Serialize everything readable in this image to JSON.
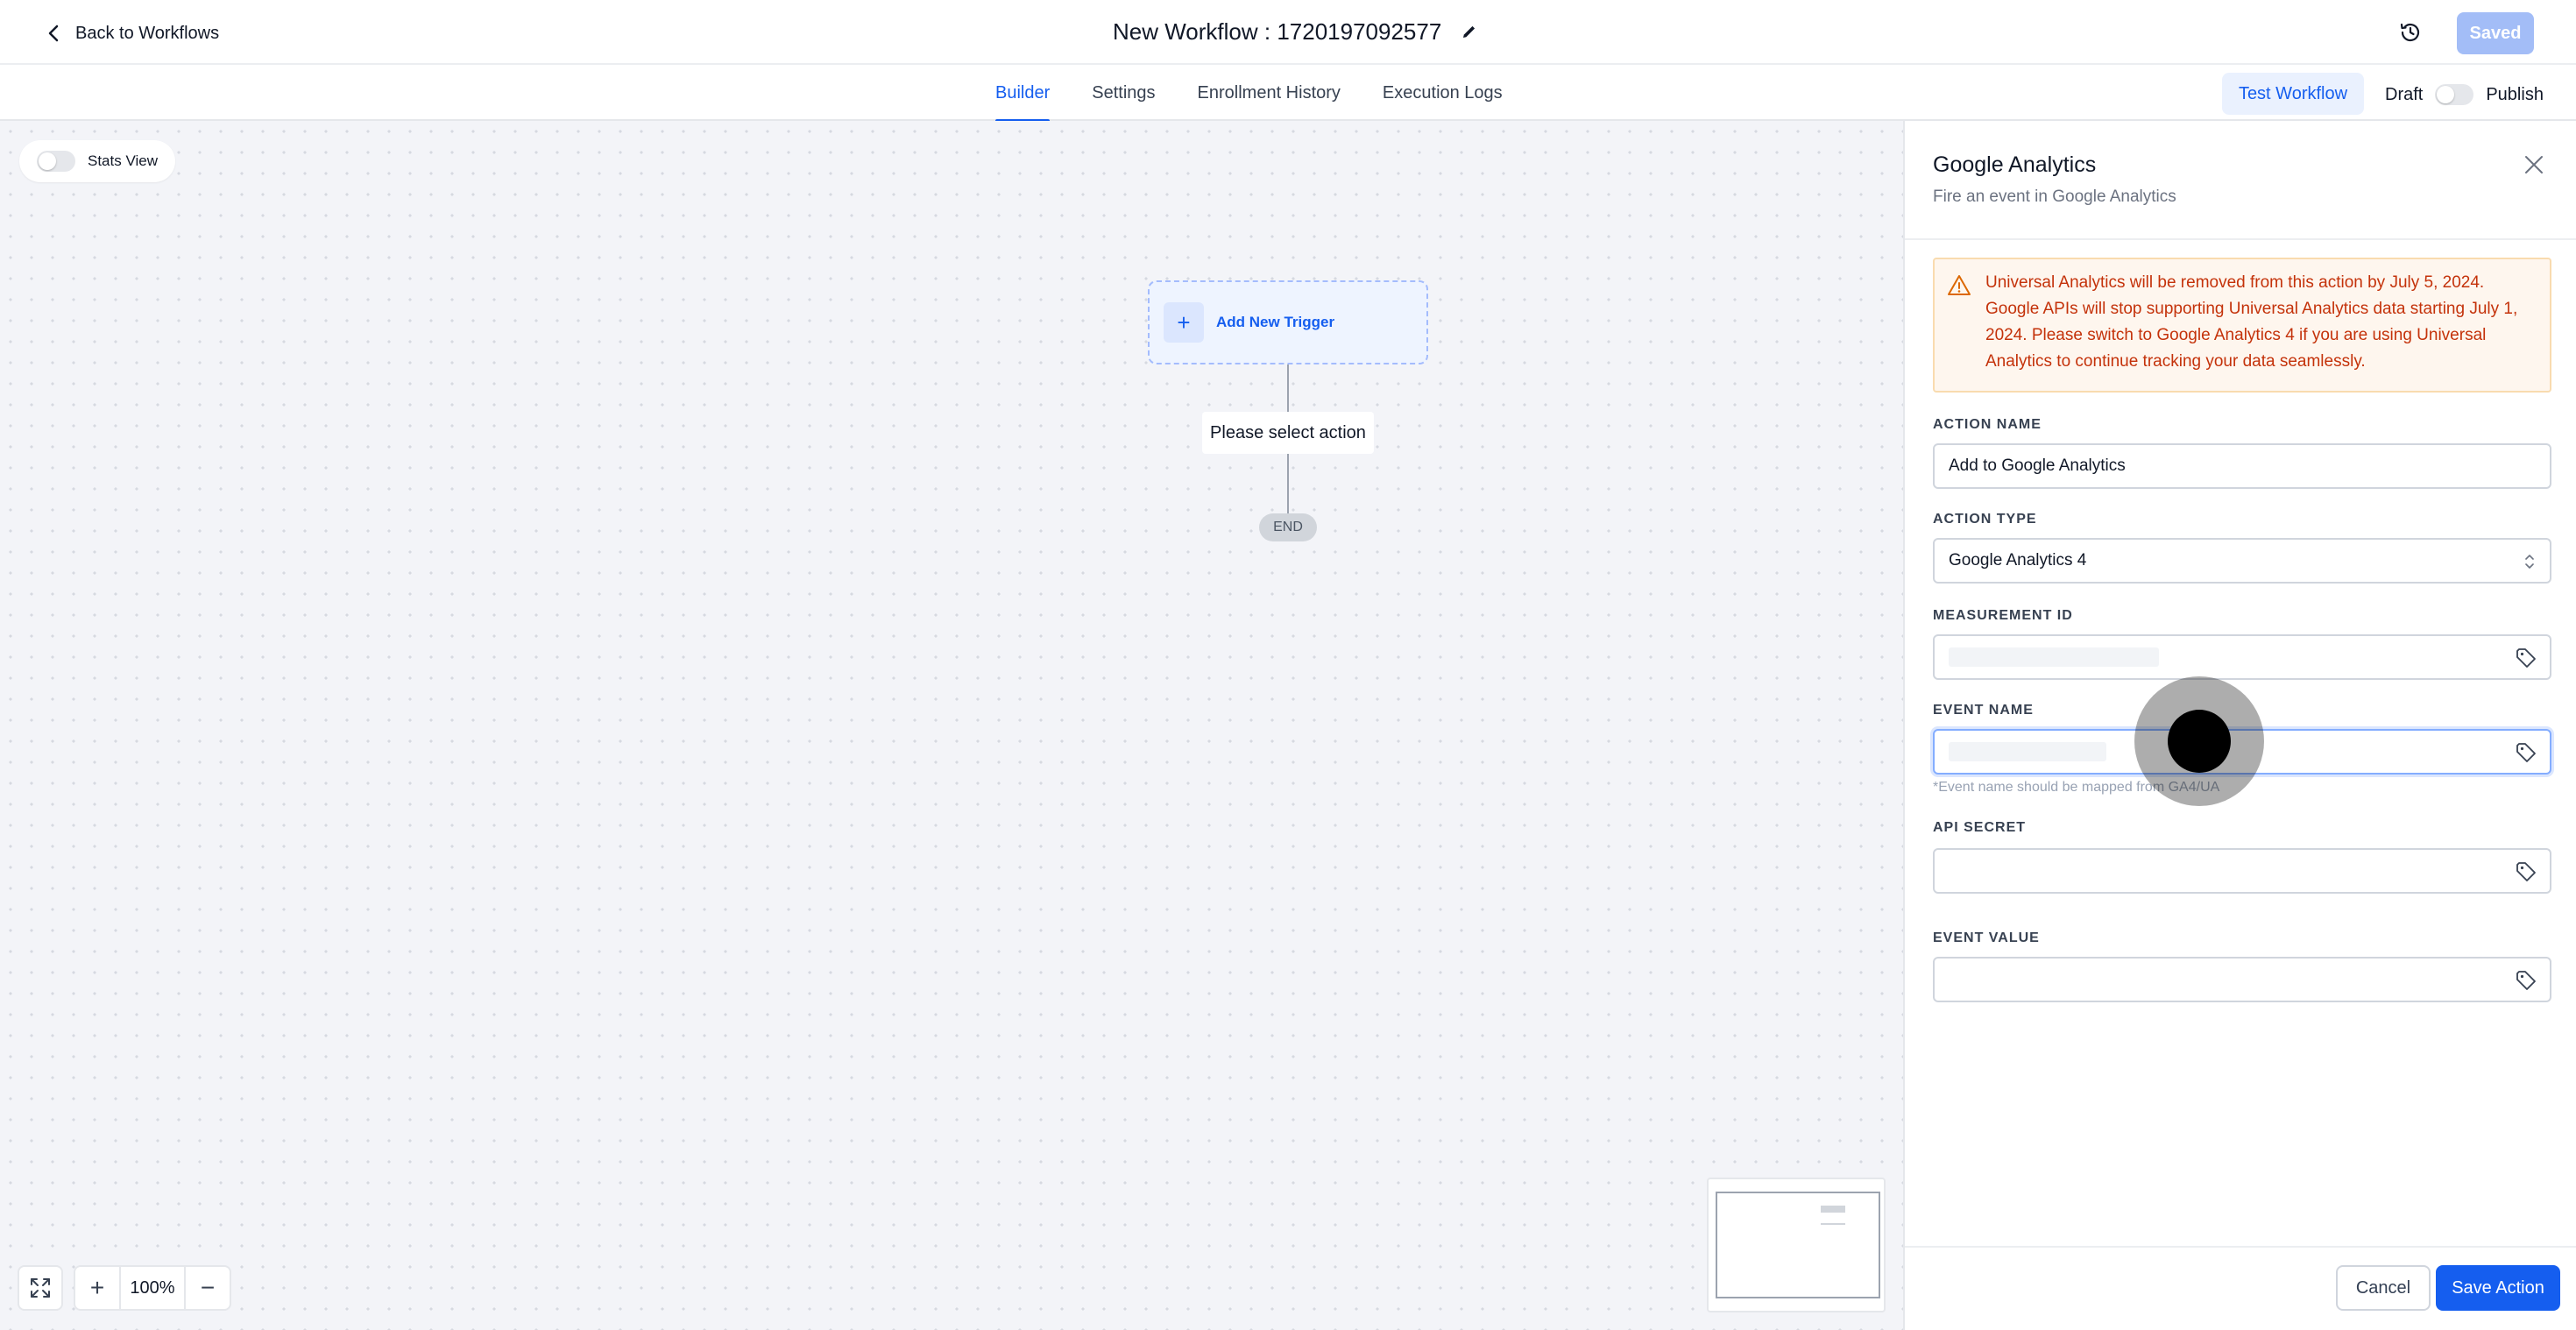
{
  "header": {
    "back_label": "Back to Workflows",
    "workflow_title": "New Workflow : 1720197092577",
    "saved_label": "Saved"
  },
  "tabs": [
    {
      "label": "Builder",
      "active": true
    },
    {
      "label": "Settings",
      "active": false
    },
    {
      "label": "Enrollment History",
      "active": false
    },
    {
      "label": "Execution Logs",
      "active": false
    }
  ],
  "toolbar": {
    "test_label": "Test Workflow",
    "draft_label": "Draft",
    "publish_label": "Publish",
    "publish_on": false
  },
  "canvas": {
    "stats_label": "Stats View",
    "stats_on": false,
    "trigger_label": "Add New Trigger",
    "action_placeholder": "Please select action",
    "end_label": "END",
    "zoom": "100%"
  },
  "panel": {
    "title": "Google Analytics",
    "subtitle": "Fire an event in Google Analytics",
    "warning": "Universal Analytics will be removed from this action by July 5, 2024. Google APIs will stop supporting Universal Analytics data starting July 1, 2024. Please switch to Google Analytics 4 if you are using Universal Analytics to continue tracking your data seamlessly.",
    "fields": {
      "action_name_label": "ACTION NAME",
      "action_name_value": "Add to Google Analytics",
      "action_type_label": "ACTION TYPE",
      "action_type_value": "Google Analytics 4",
      "measurement_id_label": "MEASUREMENT ID",
      "event_name_label": "EVENT NAME",
      "event_name_hint": "*Event name should be mapped from GA4/UA",
      "api_secret_label": "API SECRET",
      "event_value_label": "EVENT VALUE"
    },
    "cancel_label": "Cancel",
    "save_label": "Save Action"
  },
  "colors": {
    "accent": "#155eef",
    "warning_text": "#c4320a",
    "warning_bg": "#fef6ee"
  }
}
